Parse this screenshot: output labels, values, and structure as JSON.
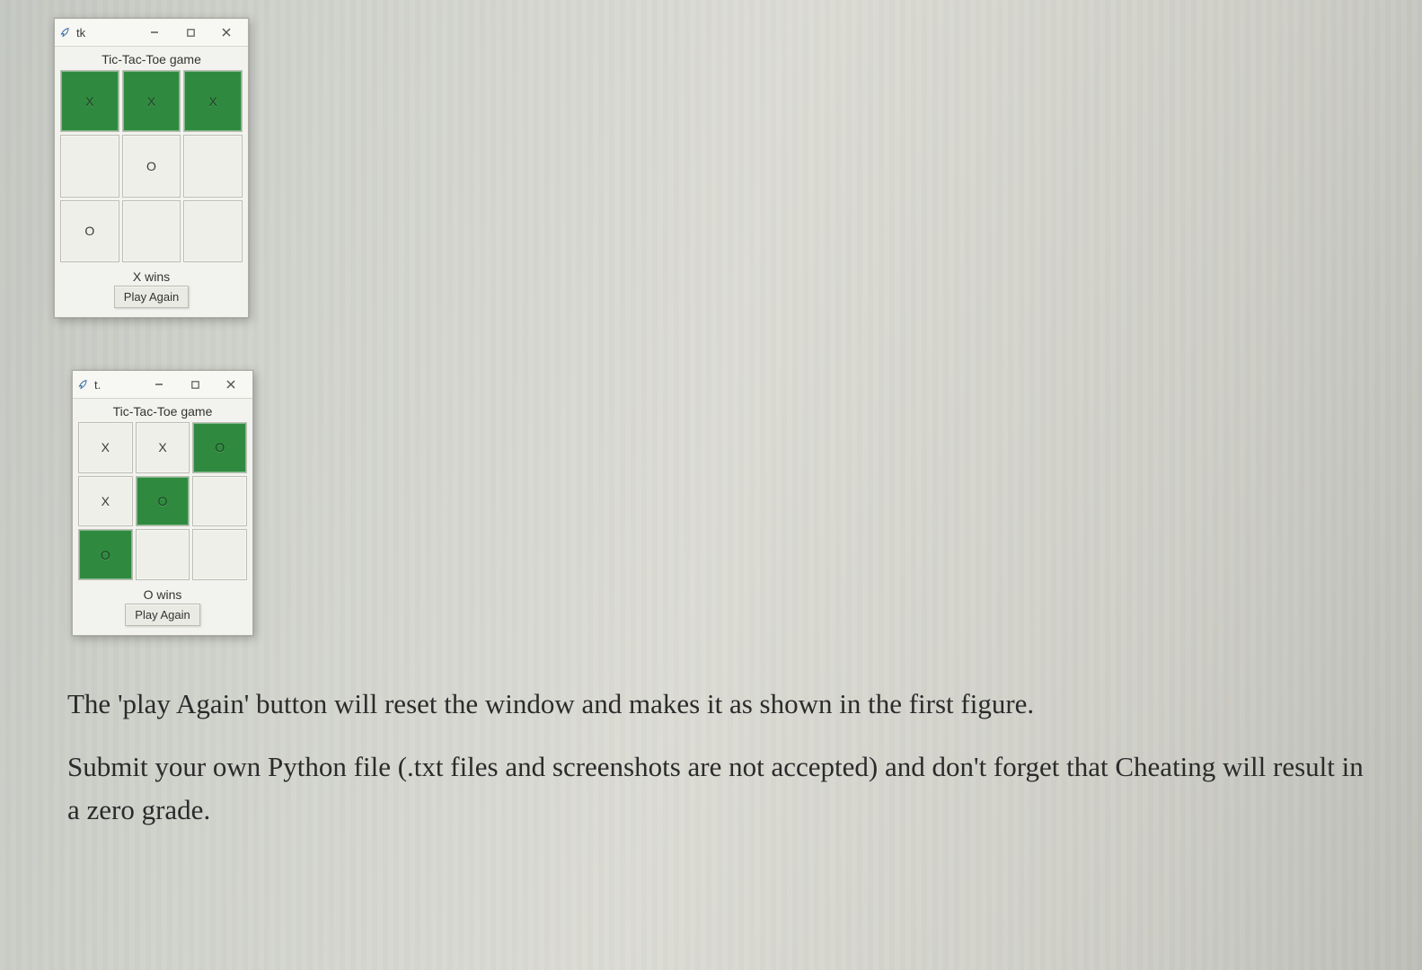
{
  "windows": [
    {
      "titlebar_title": "tk",
      "game_title": "Tic-Tac-Toe game",
      "board": [
        {
          "mark": "X",
          "win": true
        },
        {
          "mark": "X",
          "win": true
        },
        {
          "mark": "X",
          "win": true
        },
        {
          "mark": "",
          "win": false
        },
        {
          "mark": "O",
          "win": false
        },
        {
          "mark": "",
          "win": false
        },
        {
          "mark": "O",
          "win": false
        },
        {
          "mark": "",
          "win": false
        },
        {
          "mark": "",
          "win": false
        }
      ],
      "status": "X wins",
      "play_again_label": "Play Again"
    },
    {
      "titlebar_title": "t.",
      "game_title": "Tic-Tac-Toe game",
      "board": [
        {
          "mark": "X",
          "win": false
        },
        {
          "mark": "X",
          "win": false
        },
        {
          "mark": "O",
          "win": true
        },
        {
          "mark": "X",
          "win": false
        },
        {
          "mark": "O",
          "win": true
        },
        {
          "mark": "",
          "win": false
        },
        {
          "mark": "O",
          "win": true
        },
        {
          "mark": "",
          "win": false
        },
        {
          "mark": "",
          "win": false
        }
      ],
      "status": "O wins",
      "play_again_label": "Play Again"
    }
  ],
  "body_paragraphs": [
    "The 'play Again' button will reset the window and makes it as shown in the first figure.",
    "Submit your own Python file (.txt files and screenshots are not accepted) and don't forget that Cheating will result in a zero grade."
  ]
}
